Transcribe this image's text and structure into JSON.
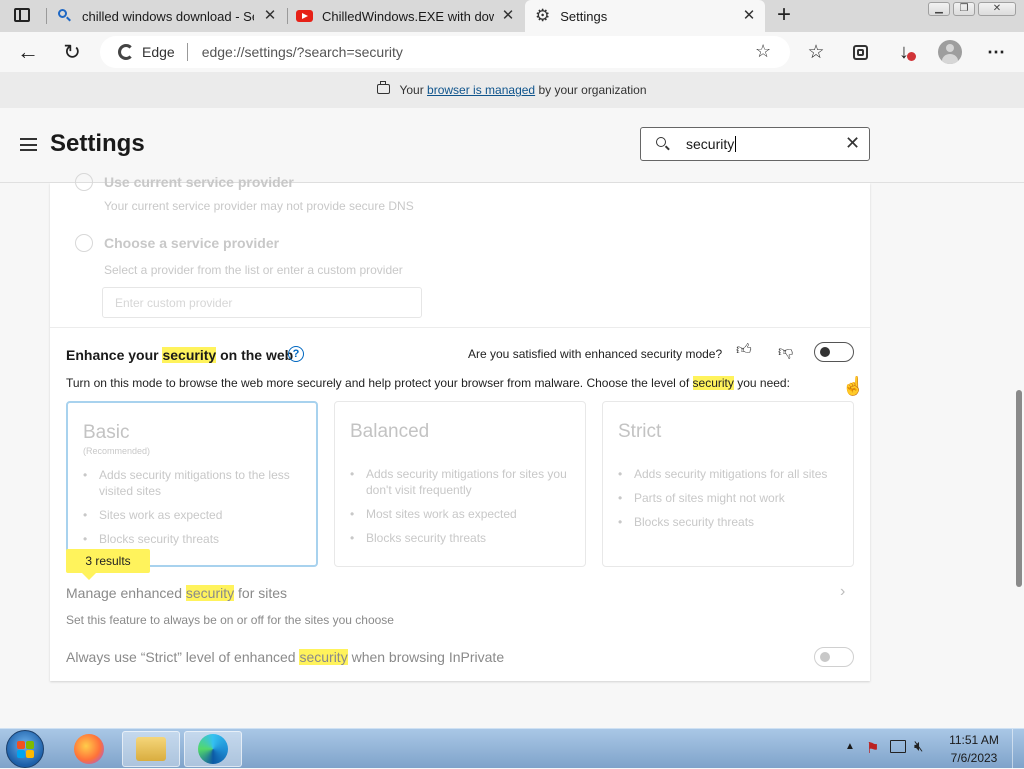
{
  "tabs": [
    {
      "title": "chilled windows download - Sear",
      "icon": "search-icon",
      "active": false
    },
    {
      "title": "ChilledWindows.EXE with downlo",
      "icon": "youtube-icon",
      "active": false
    },
    {
      "title": "Settings",
      "icon": "gear-icon",
      "active": true
    }
  ],
  "address_bar": {
    "site_label": "Edge",
    "url": "edge://settings/?search=security"
  },
  "managed_bar": {
    "prefix": "Your",
    "link": "browser is managed",
    "suffix": "by your organization"
  },
  "header": {
    "title": "Settings",
    "search_value": "security"
  },
  "dns_section": {
    "option1_label": "Use current service provider",
    "option1_desc": "Your current service provider may not provide secure DNS",
    "option2_label": "Choose a service provider",
    "option2_desc": "Select a provider from the list or enter a custom provider",
    "custom_placeholder": "Enter custom provider"
  },
  "enhance_section": {
    "title_before": "Enhance your",
    "title_highlight": "security",
    "title_after": "on the web",
    "feedback_question": "Are you satisfied with enhanced security mode?",
    "description_before": "Turn on this mode to browse the web more securely and help protect your browser from malware. Choose the level of",
    "description_highlight": "security",
    "description_after": "you need:",
    "toggle_on": false,
    "levels": [
      {
        "name": "Basic",
        "sub": "(Recommended)",
        "bullets": [
          "Adds security mitigations to the less visited sites",
          "Sites work as expected",
          "Blocks security threats"
        ],
        "selected": true
      },
      {
        "name": "Balanced",
        "sub": "",
        "bullets": [
          "Adds security mitigations for sites you don't visit frequently",
          "Most sites work as expected",
          "Blocks security threats"
        ],
        "selected": false
      },
      {
        "name": "Strict",
        "sub": "",
        "bullets": [
          "Adds security mitigations for all sites",
          "Parts of sites might not work",
          "Blocks security threats"
        ],
        "selected": false
      }
    ],
    "results_badge": "3 results",
    "manage_before": "Manage enhanced",
    "manage_highlight": "security",
    "manage_after": "for sites",
    "manage_desc": "Set this feature to always be on or off for the sites you choose",
    "inprivate_before": "Always use “Strict” level of enhanced",
    "inprivate_highlight": "security",
    "inprivate_after": "when browsing InPrivate",
    "inprivate_toggle_on": false
  },
  "taskbar": {
    "time": "11:51 AM",
    "date": "7/6/2023"
  },
  "colors": {
    "highlight": "#fff35c",
    "link": "#0f548c",
    "selected_border": "#a8d2ee",
    "accent": "#0067c0"
  }
}
